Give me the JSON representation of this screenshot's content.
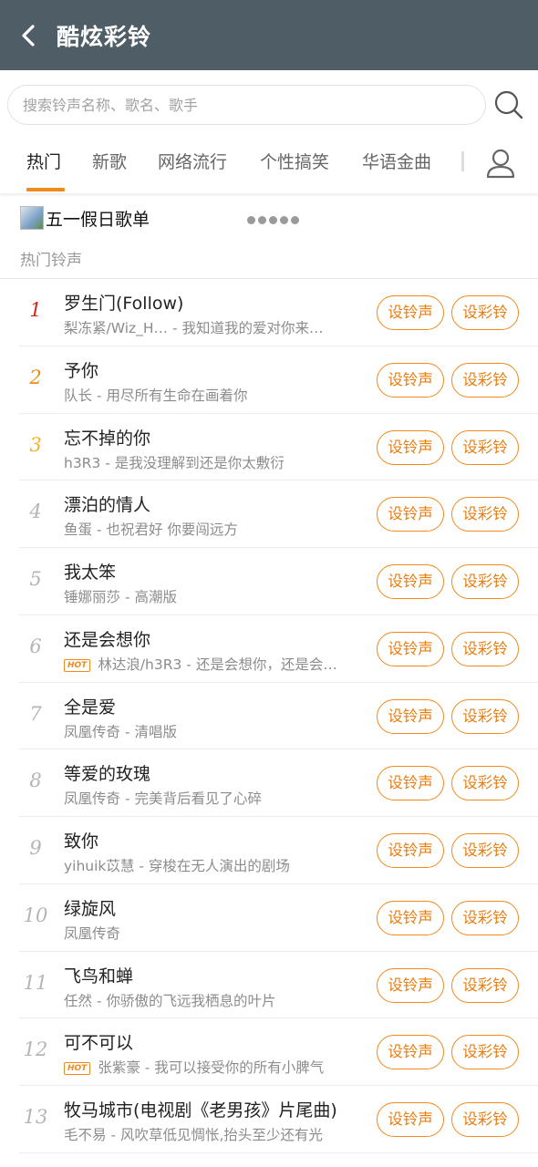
{
  "header": {
    "title": "酷炫彩铃"
  },
  "search": {
    "placeholder": "搜索铃声名称、歌名、歌手"
  },
  "tabs": [
    {
      "label": "热门"
    },
    {
      "label": "新歌"
    },
    {
      "label": "网络流行"
    },
    {
      "label": "个性搞笑"
    },
    {
      "label": "华语金曲"
    }
  ],
  "banner": {
    "text": "五一假日歌单"
  },
  "section": {
    "title": "热门铃声"
  },
  "buttons": {
    "ringtone": "设铃声",
    "crbt": "设彩铃"
  },
  "badge": {
    "hot": "HOT"
  },
  "colors": {
    "header_bg": "#4f5e66",
    "accent": "#f08a1f",
    "rank1": "#d9241c",
    "rank2": "#ee8a1a",
    "rank3": "#f2b32b"
  },
  "songs": [
    {
      "rank": "1",
      "title": "罗生门(Follow)",
      "artist": "梨冻紧/Wiz_H…",
      "desc": "我知道我的爱对你来…",
      "hot": false
    },
    {
      "rank": "2",
      "title": "予你",
      "artist": "队长",
      "desc": "用尽所有生命在画着你",
      "hot": false
    },
    {
      "rank": "3",
      "title": "忘不掉的你",
      "artist": "h3R3",
      "desc": "是我没理解到还是你太敷衍",
      "hot": false
    },
    {
      "rank": "4",
      "title": "漂泊的情人",
      "artist": "鱼蛋",
      "desc": "也祝君好 你要闯远方",
      "hot": false
    },
    {
      "rank": "5",
      "title": "我太笨",
      "artist": "锤娜丽莎",
      "desc": "高潮版",
      "hot": false
    },
    {
      "rank": "6",
      "title": "还是会想你",
      "artist": "林达浪/h3R3",
      "desc": "还是会想你，还是会…",
      "hot": true
    },
    {
      "rank": "7",
      "title": "全是爱",
      "artist": "凤凰传奇",
      "desc": "清唱版",
      "hot": false
    },
    {
      "rank": "8",
      "title": "等爱的玫瑰",
      "artist": "凤凰传奇",
      "desc": "完美背后看见了心碎",
      "hot": false
    },
    {
      "rank": "9",
      "title": "致你",
      "artist": "yihuik苡慧",
      "desc": "穿梭在无人演出的剧场",
      "hot": false
    },
    {
      "rank": "10",
      "title": "绿旋风",
      "artist": "凤凰传奇",
      "desc": "",
      "hot": false
    },
    {
      "rank": "11",
      "title": "飞鸟和蝉",
      "artist": "任然",
      "desc": "你骄傲的飞远我栖息的叶片",
      "hot": false
    },
    {
      "rank": "12",
      "title": "可不可以",
      "artist": "张紫豪",
      "desc": "我可以接受你的所有小脾气",
      "hot": true
    },
    {
      "rank": "13",
      "title": "牧马城市(电视剧《老男孩》片尾曲)",
      "artist": "毛不易",
      "desc": "风吹草低见惆怅,抬头至少还有光",
      "hot": false
    }
  ]
}
